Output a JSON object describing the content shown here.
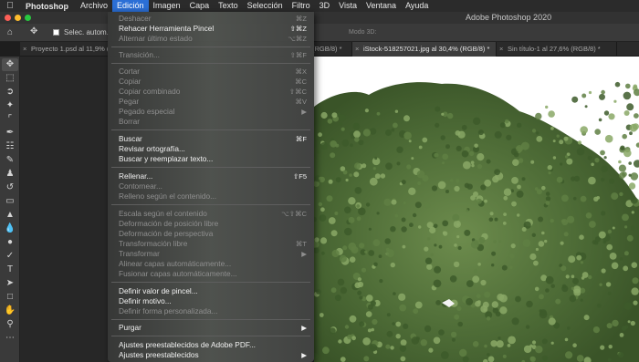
{
  "menubar": {
    "app": "Photoshop",
    "items": [
      "Archivo",
      "Edición",
      "Imagen",
      "Capa",
      "Texto",
      "Selección",
      "Filtro",
      "3D",
      "Vista",
      "Ventana",
      "Ayuda"
    ],
    "active_index": 1
  },
  "titlebar": {
    "title": "Adobe Photoshop 2020"
  },
  "options": {
    "auto_select_label": "Selec. autom.:",
    "mode_3d_label": "Modo 3D:"
  },
  "tabs": [
    {
      "label": "Proyecto 1.psd al 11,9% (...",
      "active": false
    },
    {
      "label": "(RGB/8) *",
      "active": false
    },
    {
      "label": "iStock-518257021.jpg al 30,4% (RGB/8) *",
      "active": true
    },
    {
      "label": "Sin título-1 al 27,6% (RGB/8) *",
      "active": false
    }
  ],
  "menu": {
    "undo": {
      "label": "Deshacer",
      "shortcut": "⌘Z"
    },
    "redo": {
      "label": "Rehacer Herramienta Pincel",
      "shortcut": "⇧⌘Z"
    },
    "toggle": {
      "label": "Alternar último estado",
      "shortcut": "⌥⌘Z"
    },
    "fade": {
      "label": "Transición...",
      "shortcut": "⇧⌘F"
    },
    "cut": {
      "label": "Cortar",
      "shortcut": "⌘X"
    },
    "copy": {
      "label": "Copiar",
      "shortcut": "⌘C"
    },
    "copy_merged": {
      "label": "Copiar combinado",
      "shortcut": "⇧⌘C"
    },
    "paste": {
      "label": "Pegar",
      "shortcut": "⌘V"
    },
    "paste_special": {
      "label": "Pegado especial",
      "shortcut": "▶"
    },
    "clear": {
      "label": "Borrar",
      "shortcut": ""
    },
    "find": {
      "label": "Buscar",
      "shortcut": "⌘F"
    },
    "spell": {
      "label": "Revisar ortografía...",
      "shortcut": ""
    },
    "find_replace": {
      "label": "Buscar y reemplazar texto...",
      "shortcut": ""
    },
    "fill": {
      "label": "Rellenar...",
      "shortcut": "⇧F5"
    },
    "stroke": {
      "label": "Contornear...",
      "shortcut": ""
    },
    "content_fill": {
      "label": "Relleno según el contenido...",
      "shortcut": ""
    },
    "content_scale": {
      "label": "Escala según el contenido",
      "shortcut": "⌥⇧⌘C"
    },
    "puppet": {
      "label": "Deformación de posición libre",
      "shortcut": ""
    },
    "perspective": {
      "label": "Deformación de perspectiva",
      "shortcut": ""
    },
    "free_transform": {
      "label": "Transformación libre",
      "shortcut": "⌘T"
    },
    "transform": {
      "label": "Transformar",
      "shortcut": "▶"
    },
    "auto_align": {
      "label": "Alinear capas automáticamente...",
      "shortcut": ""
    },
    "auto_blend": {
      "label": "Fusionar capas automáticamente...",
      "shortcut": ""
    },
    "brush_preset": {
      "label": "Definir valor de pincel...",
      "shortcut": ""
    },
    "pattern": {
      "label": "Definir motivo...",
      "shortcut": ""
    },
    "custom_shape": {
      "label": "Definir forma personalizada...",
      "shortcut": ""
    },
    "purge": {
      "label": "Purgar",
      "shortcut": "▶"
    },
    "pdf_presets": {
      "label": "Ajustes preestablecidos de Adobe PDF...",
      "shortcut": ""
    },
    "presets": {
      "label": "Ajustes preestablecidos",
      "shortcut": "▶"
    }
  },
  "colors": {
    "menu_highlight": "#2b6fd6",
    "foliage_dark": "#3d5a2a",
    "foliage_mid": "#5f7f43",
    "foliage_light": "#8aa866"
  }
}
